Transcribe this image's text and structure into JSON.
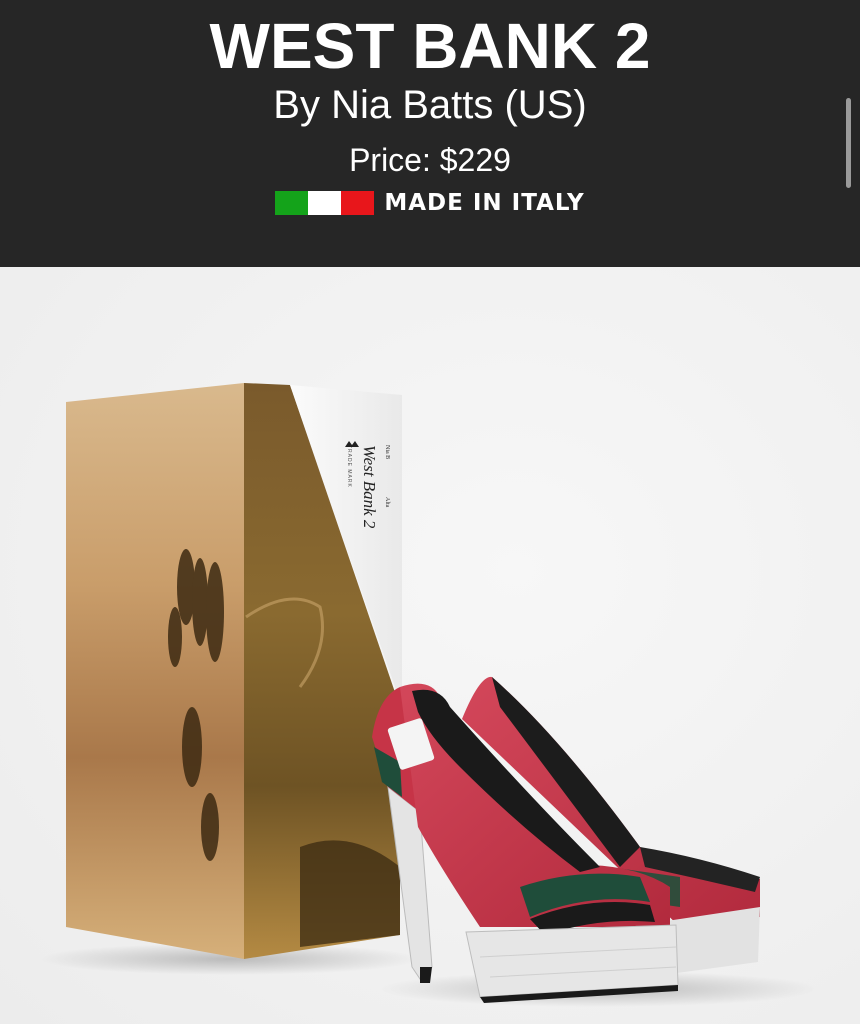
{
  "product": {
    "title": "WEST BANK 2",
    "designer": "By Nia Batts (US)",
    "price": "Price: $229",
    "origin": "MADE IN ITALY"
  },
  "flag": {
    "green": "#14a31a",
    "white": "#ffffff",
    "red": "#e8161b"
  },
  "colors": {
    "header_bg": "#262626",
    "header_text": "#ffffff",
    "shoe_red": "#c63447",
    "shoe_green": "#1f4d3a",
    "sole": "#e6e6e6"
  },
  "box_label": {
    "brand": "West Bank 2",
    "small_left": "Nia B",
    "small_right": "Alta",
    "trademark": "TRADE MARK"
  }
}
